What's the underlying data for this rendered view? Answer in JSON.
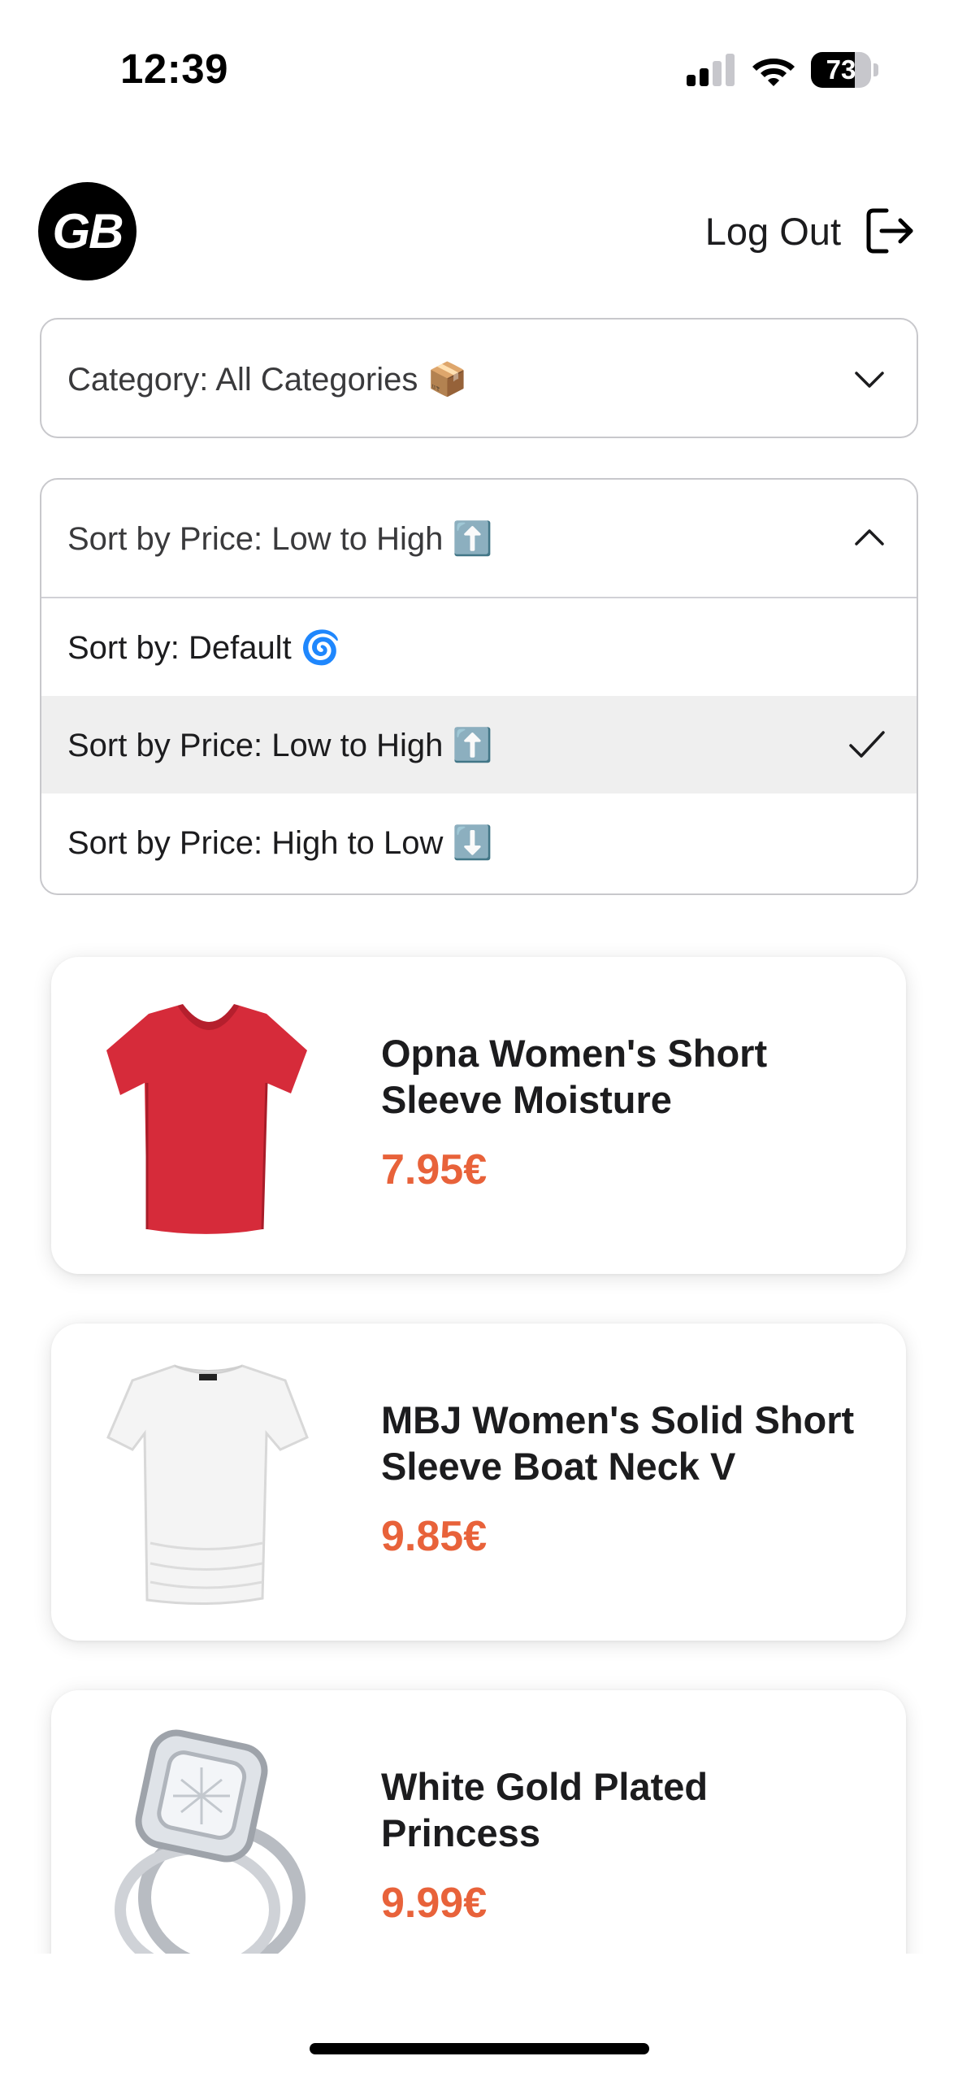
{
  "status_bar": {
    "time": "12:39",
    "battery": "73",
    "battery_level": 0.73
  },
  "header": {
    "logo_text": "GB",
    "logout_label": "Log Out"
  },
  "category_filter": {
    "label": "Category: All Categories 📦"
  },
  "sort_dropdown": {
    "selected_label": "Sort by Price: Low to High ⬆️",
    "expanded": true,
    "options": [
      {
        "label": "Sort by: Default 🌀",
        "selected": false
      },
      {
        "label": "Sort by Price: Low to High ⬆️",
        "selected": true
      },
      {
        "label": "Sort by Price: High to Low ⬇️",
        "selected": false
      }
    ]
  },
  "products": [
    {
      "title": "Opna Women's Short Sleeve Moisture",
      "price": "7.95€",
      "image": "red-tshirt"
    },
    {
      "title": "MBJ Women's Solid Short Sleeve Boat Neck V",
      "price": "9.85€",
      "image": "white-tshirt"
    },
    {
      "title": "White Gold Plated Princess",
      "price": "9.99€",
      "image": "diamond-ring"
    }
  ],
  "colors": {
    "price": "#e8623a",
    "selected_option_bg": "#efefef",
    "border": "#c8c8cc"
  }
}
